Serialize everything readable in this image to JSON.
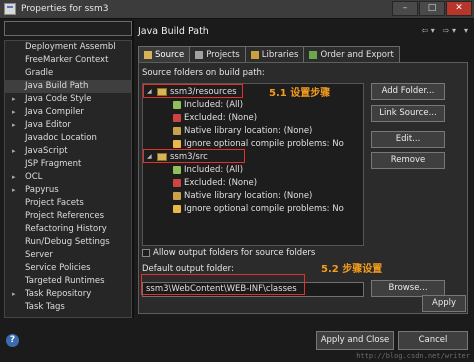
{
  "window": {
    "title": "Properties for ssm3",
    "controls": [
      "–",
      "□",
      "✕"
    ]
  },
  "sidebar": {
    "filter_value": "",
    "items": [
      {
        "label": "Deployment Assembl",
        "arrow": ""
      },
      {
        "label": "FreeMarker Context",
        "arrow": ""
      },
      {
        "label": "Gradle",
        "arrow": ""
      },
      {
        "label": "Java Build Path",
        "arrow": "",
        "selected": true
      },
      {
        "label": "Java Code Style",
        "arrow": "▸"
      },
      {
        "label": "Java Compiler",
        "arrow": "▸"
      },
      {
        "label": "Java Editor",
        "arrow": "▸"
      },
      {
        "label": "Javadoc Location",
        "arrow": ""
      },
      {
        "label": "JavaScript",
        "arrow": "▸"
      },
      {
        "label": "JSP Fragment",
        "arrow": ""
      },
      {
        "label": "OCL",
        "arrow": "▸"
      },
      {
        "label": "Papyrus",
        "arrow": "▸"
      },
      {
        "label": "Project Facets",
        "arrow": ""
      },
      {
        "label": "Project References",
        "arrow": ""
      },
      {
        "label": "Refactoring History",
        "arrow": ""
      },
      {
        "label": "Run/Debug Settings",
        "arrow": ""
      },
      {
        "label": "Server",
        "arrow": ""
      },
      {
        "label": "Service Policies",
        "arrow": ""
      },
      {
        "label": "Targeted Runtimes",
        "arrow": ""
      },
      {
        "label": "Task Repository",
        "arrow": "▸"
      },
      {
        "label": "Task Tags",
        "arrow": ""
      }
    ]
  },
  "header": {
    "title": "Java Build Path",
    "nav": [
      "⇦ ▾",
      "⇨ ▾",
      "▾"
    ]
  },
  "tabs": [
    {
      "label": "Source",
      "active": true,
      "icon_color": "#d7b45a"
    },
    {
      "label": "Projects",
      "active": false,
      "icon_color": "#a0a0a0"
    },
    {
      "label": "Libraries",
      "active": false,
      "icon_color": "#c9a040"
    },
    {
      "label": "Order and Export",
      "active": false,
      "icon_color": "#6aa84f"
    }
  ],
  "source": {
    "folders_label": "Source folders on build path:",
    "folders": [
      {
        "name": "ssm3/resources",
        "children": [
          "Included: (All)",
          "Excluded: (None)",
          "Native library location: (None)",
          "Ignore optional compile problems: No"
        ]
      },
      {
        "name": "ssm3/src",
        "children": [
          "Included: (All)",
          "Excluded: (None)",
          "Native library location: (None)",
          "Ignore optional compile problems: No"
        ]
      }
    ],
    "child_icon_colors": [
      "#8fbf5a",
      "#c44",
      "#caa24a",
      "#e8b84a"
    ],
    "allow_output_label": "Allow output folders for source folders",
    "allow_output_checked": false,
    "default_output_label": "Default output folder:",
    "default_output_value": "ssm3\\WebContent\\WEB-INF\\classes"
  },
  "buttons": {
    "add_folder": "Add Folder...",
    "link_source": "Link Source...",
    "edit": "Edit...",
    "remove": "Remove",
    "browse": "Browse...",
    "apply": "Apply",
    "apply_close": "Apply and Close",
    "cancel": "Cancel"
  },
  "annotations": {
    "step1": "5.1 设置步骤",
    "step2": "5.2 步骤设置",
    "color": "#e0322b",
    "text_color": "#f39c1e"
  },
  "watermark": "http://blog.csdn.net/writer",
  "help_icon": "?"
}
